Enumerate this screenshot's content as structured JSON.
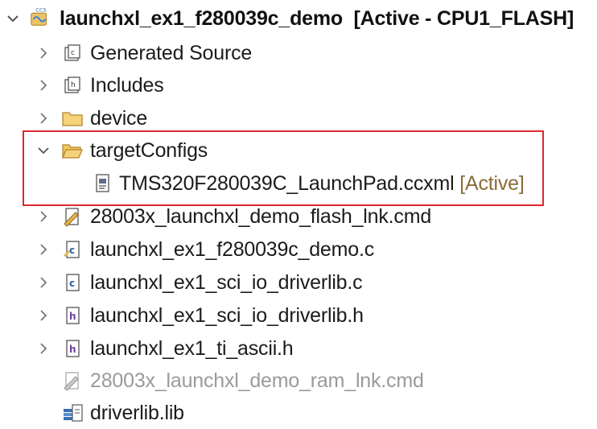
{
  "project": {
    "name": "launchxl_ex1_f280039c_demo",
    "suffix": "[Active - CPU1_FLASH]",
    "icon": "ccs-project-icon",
    "icon_badge": "CCS"
  },
  "items": [
    {
      "label": "Generated Source",
      "icon": "generated-source-folder-icon",
      "expanded": false
    },
    {
      "label": "Includes",
      "icon": "includes-folder-icon",
      "expanded": false
    },
    {
      "label": "device",
      "icon": "folder-icon",
      "expanded": false
    },
    {
      "label": "targetConfigs",
      "icon": "folder-open-icon",
      "expanded": true
    },
    {
      "label": "TMS320F280039C_LaunchPad.ccxml",
      "tag": "[Active]",
      "icon": "ccxml-file-icon"
    },
    {
      "label": "28003x_launchxl_demo_flash_lnk.cmd",
      "icon": "cmd-file-icon",
      "expanded": false
    },
    {
      "label": "launchxl_ex1_f280039c_demo.c",
      "icon": "c-file-icon",
      "expanded": false
    },
    {
      "label": "launchxl_ex1_sci_io_driverlib.c",
      "icon": "c-file-icon",
      "expanded": false
    },
    {
      "label": "launchxl_ex1_sci_io_driverlib.h",
      "icon": "h-file-icon",
      "expanded": false
    },
    {
      "label": "launchxl_ex1_ti_ascii.h",
      "icon": "h-file-icon",
      "expanded": false
    },
    {
      "label": "28003x_launchxl_demo_ram_lnk.cmd",
      "icon": "cmd-file-excluded-icon",
      "excluded": true
    },
    {
      "label": "driverlib.lib",
      "icon": "library-file-icon"
    }
  ],
  "colors": {
    "highlight_border": "#e0262f",
    "active_tag": "#8a6d3b",
    "excluded_text": "#9a9a9a",
    "folder": "#e3b553"
  }
}
